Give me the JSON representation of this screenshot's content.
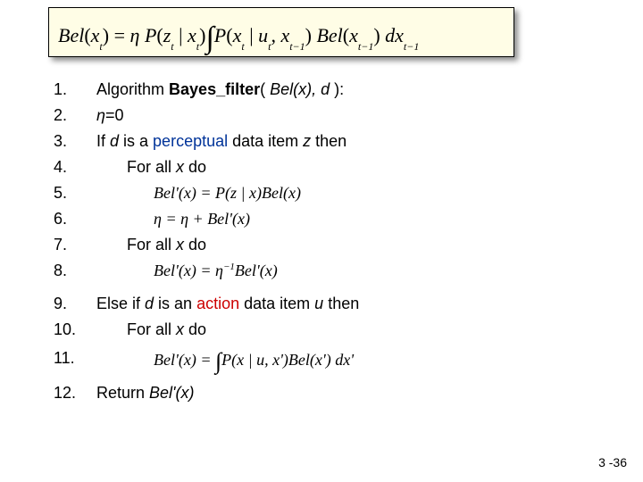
{
  "equation": {
    "lhs_fn": "Bel",
    "lhs_arg_base": "x",
    "lhs_arg_sub": "t",
    "eq": " = ",
    "eta": "η",
    "sp": " ",
    "P": "P",
    "z_base": "z",
    "z_sub": "t",
    "bar": " | ",
    "x_base": "x",
    "x_sub": "t",
    "int": "∫",
    "u_base": "u",
    "u_sub": "t",
    "comma": ", ",
    "xm1_base": "x",
    "xm1_sub": "t−1",
    "Bel2": "Bel",
    "dx_d": " d",
    "dx_base": "x",
    "dx_sub": "t−1"
  },
  "lines": {
    "l1": {
      "n": "1.",
      "pre": "Algorithm ",
      "fn": "Bayes_filter",
      "open": "( ",
      "a1": "Bel(x)",
      "c": ", ",
      "a2": "d",
      "close": " ):"
    },
    "l2": {
      "n": "2.",
      "eta": "η",
      "eq": "=",
      "zero": "0"
    },
    "l3": {
      "n": "3.",
      "t1": "If ",
      "d": "d",
      "t2": " is a ",
      "perc": "perceptual",
      "t3": " data item ",
      "z": "z",
      "t4": " then"
    },
    "l4": {
      "n": "4.",
      "t": "For all ",
      "x": "x",
      "do": " do"
    },
    "l5": {
      "n": "5.",
      "eq_l": "Bel'",
      "lp": "(",
      "x": "x",
      "rp": ")",
      "eq": " = ",
      "P": "P",
      "lp2": "(",
      "z": "z",
      "bar": " | ",
      "x2": "x",
      "rp2": ")",
      "Bel": "Bel",
      "lp3": "(",
      "x3": "x",
      "rp3": ")"
    },
    "l6": {
      "n": "6.",
      "eta": "η",
      "eq": " = ",
      "eta2": "η",
      "plus": " + ",
      "Bel": "Bel'",
      "lp": "(",
      "x": "x",
      "rp": ")"
    },
    "l7": {
      "n": "7.",
      "t": "For all ",
      "x": "x",
      "do": " do"
    },
    "l8": {
      "n": "8.",
      "Bel": "Bel'",
      "lp": "(",
      "x": "x",
      "rp": ")",
      "eq": " = ",
      "eta": "η",
      "exp": "−1",
      "Bel2": "Bel'",
      "lp2": "(",
      "x2": "x",
      "rp2": ")"
    },
    "l9": {
      "n": "9.",
      "t1": "Else if ",
      "d": "d",
      "t2": " is an ",
      "act": "action",
      "t3": " data item ",
      "u": "u",
      "t4": " then"
    },
    "l10": {
      "n": "10.",
      "t": "For all ",
      "x": "x",
      "do": " do"
    },
    "l11": {
      "n": "11.",
      "Bel": "Bel'",
      "lp": "(",
      "x": "x",
      "rp": ")",
      "eq": " = ",
      "int": "∫",
      "P": "P",
      "lp2": "(",
      "x2": "x",
      "bar": " | ",
      "u": "u",
      "c": ", ",
      "xp": "x'",
      "rp2": ")",
      "Bel2": "Bel",
      "lp3": "(",
      "xp2": "x'",
      "rp3": ")",
      "dx": " dx'"
    },
    "l12": {
      "n": "12.",
      "t": "Return ",
      "r": "Bel'(x)"
    }
  },
  "footer": "3 -36"
}
